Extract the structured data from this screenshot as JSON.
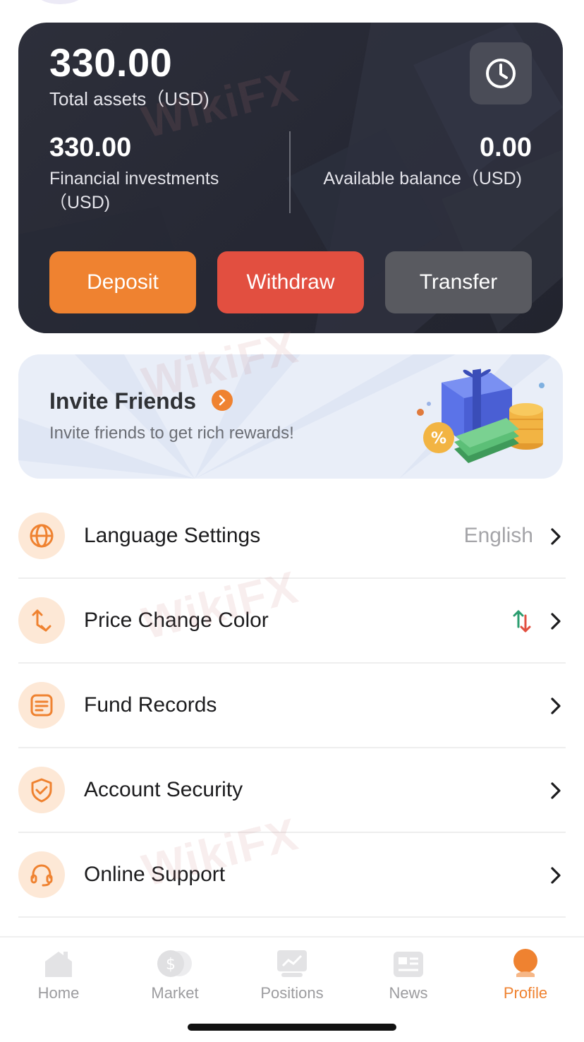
{
  "assets": {
    "total_value": "330.00",
    "total_label": "Total assets（USD)",
    "financial_value": "330.00",
    "financial_label": "Financial investments（USD)",
    "available_value": "0.00",
    "available_label": "Available balance（USD)",
    "buttons": {
      "deposit": "Deposit",
      "withdraw": "Withdraw",
      "transfer": "Transfer"
    }
  },
  "invite": {
    "title": "Invite Friends",
    "subtitle": "Invite friends to get rich rewards!"
  },
  "settings": [
    {
      "label": "Language Settings",
      "value": "English",
      "icon": "globe-icon"
    },
    {
      "label": "Price Change Color",
      "value": "",
      "icon": "price-change-icon"
    },
    {
      "label": "Fund Records",
      "value": "",
      "icon": "document-icon"
    },
    {
      "label": "Account Security",
      "value": "",
      "icon": "shield-check-icon"
    },
    {
      "label": "Online Support",
      "value": "",
      "icon": "headset-icon"
    }
  ],
  "tabs": [
    {
      "label": "Home",
      "icon": "home-icon",
      "active": false
    },
    {
      "label": "Market",
      "icon": "market-icon",
      "active": false
    },
    {
      "label": "Positions",
      "icon": "positions-icon",
      "active": false
    },
    {
      "label": "News",
      "icon": "news-icon",
      "active": false
    },
    {
      "label": "Profile",
      "icon": "profile-icon",
      "active": true
    }
  ],
  "watermark": "WikiFX",
  "colors": {
    "accent": "#ef8230",
    "withdraw": "#e24f40",
    "transfer": "#595a60",
    "card_bg": "#2a2c37",
    "up": "#2a9d6f",
    "down": "#e24f40"
  }
}
